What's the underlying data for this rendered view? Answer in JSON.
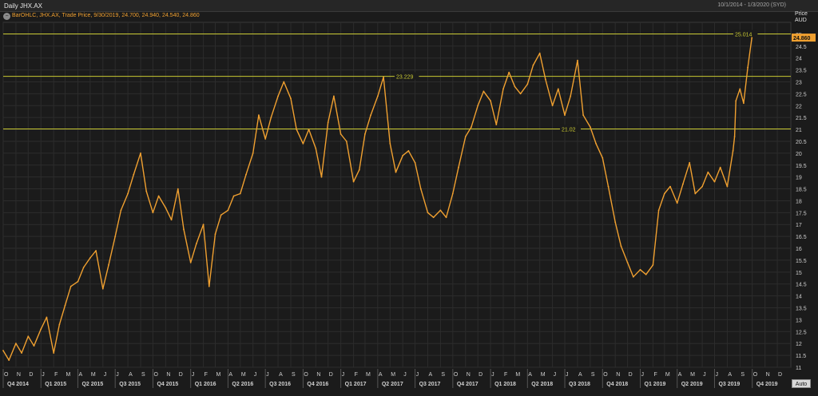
{
  "header": {
    "title": "Daily JHX.AX",
    "date_range": "10/1/2014 - 1/3/2020 (SYD)",
    "legend": "BarOHLC, JHX.AX, Trade Price, 9/30/2019, 24.700, 24.940, 24.540, 24.860",
    "legend_icon": "minus-icon",
    "price_label": "Price",
    "currency_label": "AUD"
  },
  "controls": {
    "auto_label": "Auto"
  },
  "colors": {
    "series": "#f0a030",
    "hline": "#c8c832",
    "last_price_bg": "#f0a030",
    "background": "#1b1b1b",
    "grid": "#2c2c2c"
  },
  "chart_data": {
    "type": "line",
    "title": "Daily JHX.AX",
    "ylabel": "Price AUD",
    "ylim": [
      11,
      25.5
    ],
    "yticks": [
      11,
      11.5,
      12,
      12.5,
      13,
      13.5,
      14,
      14.5,
      15,
      15.5,
      16,
      16.5,
      17,
      17.5,
      18,
      18.5,
      19,
      19.5,
      20,
      20.5,
      21,
      21.5,
      22,
      22.5,
      23,
      23.5,
      24,
      24.5,
      25
    ],
    "grid": true,
    "month_labels": [
      "O",
      "N",
      "D",
      "J",
      "F",
      "M",
      "A",
      "M",
      "J",
      "J",
      "A",
      "S",
      "O",
      "N",
      "D",
      "J",
      "F",
      "M",
      "A",
      "M",
      "J",
      "J",
      "A",
      "S",
      "O",
      "N",
      "D",
      "J",
      "F",
      "M",
      "A",
      "M",
      "J",
      "J",
      "A",
      "S",
      "O",
      "N",
      "D",
      "J",
      "F",
      "M",
      "A",
      "M",
      "J",
      "J",
      "A",
      "S",
      "O",
      "N",
      "D",
      "J",
      "F",
      "M",
      "A",
      "M",
      "J",
      "J",
      "A",
      "S",
      "O",
      "N",
      "D"
    ],
    "quarter_labels": [
      "Q4 2014",
      "Q1 2015",
      "Q2 2015",
      "Q3 2015",
      "Q4 2015",
      "Q1 2016",
      "Q2 2016",
      "Q3 2016",
      "Q4 2016",
      "Q1 2017",
      "Q2 2017",
      "Q3 2017",
      "Q4 2017",
      "Q1 2018",
      "Q2 2018",
      "Q3 2018",
      "Q4 2018",
      "Q1 2019",
      "Q2 2019",
      "Q3 2019",
      "Q4 2019"
    ],
    "x_start": "2014-10-01",
    "series": [
      {
        "values": [
          [
            "2014-10-01",
            11.7
          ],
          [
            "2014-10-15",
            11.3
          ],
          [
            "2014-11-01",
            12.0
          ],
          [
            "2014-11-15",
            11.6
          ],
          [
            "2014-12-01",
            12.3
          ],
          [
            "2014-12-15",
            11.9
          ],
          [
            "2015-01-01",
            12.6
          ],
          [
            "2015-01-15",
            13.1
          ],
          [
            "2015-02-01",
            11.6
          ],
          [
            "2015-02-15",
            12.8
          ],
          [
            "2015-03-01",
            13.6
          ],
          [
            "2015-03-15",
            14.4
          ],
          [
            "2015-04-01",
            14.6
          ],
          [
            "2015-04-15",
            15.2
          ],
          [
            "2015-05-01",
            15.6
          ],
          [
            "2015-05-15",
            15.9
          ],
          [
            "2015-06-01",
            14.3
          ],
          [
            "2015-06-15",
            15.3
          ],
          [
            "2015-07-01",
            16.5
          ],
          [
            "2015-07-15",
            17.6
          ],
          [
            "2015-08-01",
            18.3
          ],
          [
            "2015-08-15",
            19.1
          ],
          [
            "2015-09-01",
            20.0
          ],
          [
            "2015-09-15",
            18.4
          ],
          [
            "2015-10-01",
            17.5
          ],
          [
            "2015-10-15",
            18.2
          ],
          [
            "2015-11-01",
            17.7
          ],
          [
            "2015-11-15",
            17.2
          ],
          [
            "2015-12-01",
            18.5
          ],
          [
            "2015-12-15",
            16.8
          ],
          [
            "2016-01-01",
            15.4
          ],
          [
            "2016-01-15",
            16.2
          ],
          [
            "2016-02-01",
            17.0
          ],
          [
            "2016-02-15",
            14.4
          ],
          [
            "2016-03-01",
            16.6
          ],
          [
            "2016-03-15",
            17.4
          ],
          [
            "2016-04-01",
            17.6
          ],
          [
            "2016-04-15",
            18.2
          ],
          [
            "2016-05-01",
            18.3
          ],
          [
            "2016-05-15",
            19.1
          ],
          [
            "2016-06-01",
            20.0
          ],
          [
            "2016-06-15",
            21.6
          ],
          [
            "2016-07-01",
            20.6
          ],
          [
            "2016-07-15",
            21.5
          ],
          [
            "2016-08-01",
            22.4
          ],
          [
            "2016-08-15",
            23.0
          ],
          [
            "2016-09-01",
            22.3
          ],
          [
            "2016-09-15",
            21.0
          ],
          [
            "2016-10-01",
            20.4
          ],
          [
            "2016-10-15",
            21.0
          ],
          [
            "2016-11-01",
            20.2
          ],
          [
            "2016-11-15",
            19.0
          ],
          [
            "2016-12-01",
            21.3
          ],
          [
            "2016-12-15",
            22.4
          ],
          [
            "2017-01-01",
            20.8
          ],
          [
            "2017-01-15",
            20.5
          ],
          [
            "2017-02-01",
            18.8
          ],
          [
            "2017-02-15",
            19.3
          ],
          [
            "2017-03-01",
            20.8
          ],
          [
            "2017-03-15",
            21.6
          ],
          [
            "2017-04-01",
            22.4
          ],
          [
            "2017-04-15",
            23.2
          ],
          [
            "2017-05-01",
            20.4
          ],
          [
            "2017-05-15",
            19.2
          ],
          [
            "2017-06-01",
            19.9
          ],
          [
            "2017-06-15",
            20.1
          ],
          [
            "2017-07-01",
            19.6
          ],
          [
            "2017-07-15",
            18.5
          ],
          [
            "2017-08-01",
            17.5
          ],
          [
            "2017-08-15",
            17.3
          ],
          [
            "2017-09-01",
            17.6
          ],
          [
            "2017-09-15",
            17.3
          ],
          [
            "2017-10-01",
            18.3
          ],
          [
            "2017-10-15",
            19.4
          ],
          [
            "2017-11-01",
            20.7
          ],
          [
            "2017-11-15",
            21.1
          ],
          [
            "2017-12-01",
            22.0
          ],
          [
            "2017-12-15",
            22.6
          ],
          [
            "2018-01-01",
            22.2
          ],
          [
            "2018-01-15",
            21.2
          ],
          [
            "2018-02-01",
            22.7
          ],
          [
            "2018-02-15",
            23.4
          ],
          [
            "2018-03-01",
            22.8
          ],
          [
            "2018-03-15",
            22.5
          ],
          [
            "2018-04-01",
            22.9
          ],
          [
            "2018-04-15",
            23.7
          ],
          [
            "2018-05-01",
            24.2
          ],
          [
            "2018-05-15",
            23.1
          ],
          [
            "2018-06-01",
            22.0
          ],
          [
            "2018-06-15",
            22.7
          ],
          [
            "2018-07-01",
            21.6
          ],
          [
            "2018-07-15",
            22.4
          ],
          [
            "2018-08-01",
            23.9
          ],
          [
            "2018-08-15",
            21.6
          ],
          [
            "2018-09-01",
            21.1
          ],
          [
            "2018-09-15",
            20.4
          ],
          [
            "2018-10-01",
            19.8
          ],
          [
            "2018-10-15",
            18.6
          ],
          [
            "2018-11-01",
            17.1
          ],
          [
            "2018-11-15",
            16.1
          ],
          [
            "2018-12-01",
            15.4
          ],
          [
            "2018-12-15",
            14.8
          ],
          [
            "2019-01-01",
            15.1
          ],
          [
            "2019-01-15",
            14.9
          ],
          [
            "2019-02-01",
            15.3
          ],
          [
            "2019-02-15",
            17.6
          ],
          [
            "2019-03-01",
            18.3
          ],
          [
            "2019-03-15",
            18.6
          ],
          [
            "2019-04-01",
            17.9
          ],
          [
            "2019-04-15",
            18.7
          ],
          [
            "2019-05-01",
            19.6
          ],
          [
            "2019-05-15",
            18.3
          ],
          [
            "2019-06-01",
            18.6
          ],
          [
            "2019-06-15",
            19.2
          ],
          [
            "2019-07-01",
            18.8
          ],
          [
            "2019-07-15",
            19.4
          ],
          [
            "2019-08-01",
            18.6
          ],
          [
            "2019-08-15",
            20.1
          ],
          [
            "2019-08-19",
            20.7
          ],
          [
            "2019-08-22",
            22.2
          ],
          [
            "2019-09-01",
            22.7
          ],
          [
            "2019-09-10",
            22.1
          ],
          [
            "2019-09-20",
            23.6
          ],
          [
            "2019-09-30",
            24.86
          ]
        ]
      }
    ],
    "reference_lines": [
      {
        "value": 25.014,
        "label": "25.014"
      },
      {
        "value": 23.229,
        "label": "23.229"
      },
      {
        "value": 21.02,
        "label": "21.02"
      }
    ],
    "last_price": {
      "value": 24.86,
      "label": "24.860"
    }
  }
}
